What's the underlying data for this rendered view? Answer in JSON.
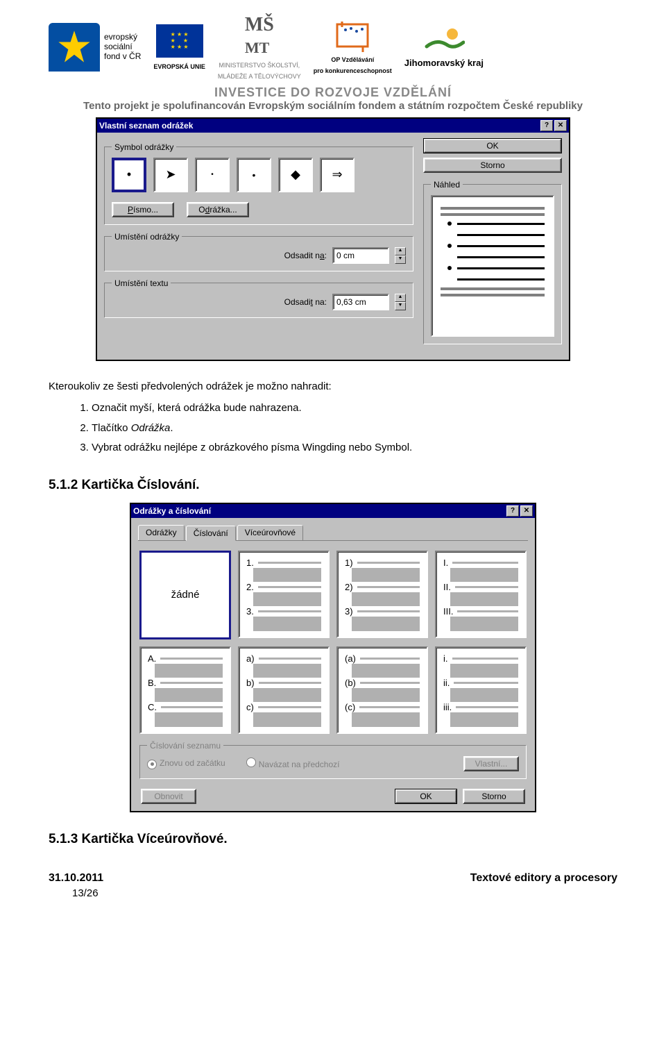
{
  "header": {
    "esf_text1": "evropský",
    "esf_text2": "sociální",
    "esf_text3": "fond v ČR",
    "eu_label": "EVROPSKÁ UNIE",
    "msmt_line1": "MINISTERSTVO ŠKOLSTVÍ,",
    "msmt_line2": "MLÁDEŽE A TĚLOVÝCHOVY",
    "op_line1": "OP Vzdělávání",
    "op_line2": "pro konkurenceschopnost",
    "jmk": "Jihomoravský kraj",
    "invest": "INVESTICE DO ROZVOJE VZDĚLÁNÍ",
    "cofund": "Tento projekt je spolufinancován Evropským sociálním fondem a státním rozpočtem České republiky"
  },
  "dialog1": {
    "title": "Vlastní seznam odrážek",
    "group_symbol": "Symbol odrážky",
    "btn_font": "Písmo...",
    "btn_bullet": "Odrážka...",
    "group_bullet_pos": "Umístění odrážky",
    "indent_at1_label": "Odsadit na:",
    "indent_at1_value": "0 cm",
    "group_text_pos": "Umístění textu",
    "indent_at2_label": "Odsadit na:",
    "indent_at2_value": "0,63 cm",
    "ok": "OK",
    "storno": "Storno",
    "preview_label": "Náhled",
    "symbols": [
      "•",
      "➤",
      "•",
      "•",
      "◆",
      "⇒"
    ]
  },
  "body": {
    "intro": "Kteroukoliv ze šesti předvolených odrážek je možno nahradit:",
    "steps": [
      "Označit myší, která odrážka bude nahrazena.",
      "Tlačítko Odrážka.",
      "Vybrat odrážku nejlépe z obrázkového písma Wingding nebo Symbol."
    ],
    "step2_italic": "Odrážka",
    "h512": "5.1.2 Kartička Číslování."
  },
  "dialog2": {
    "title": "Odrážky a číslování",
    "tabs": [
      "Odrážky",
      "Číslování",
      "Víceúrovňové"
    ],
    "active_tab": 1,
    "box_none": "žádné",
    "numbering": {
      "r1c2": [
        "1.",
        "2.",
        "3."
      ],
      "r1c3": [
        "1)",
        "2)",
        "3)"
      ],
      "r1c4": [
        "I.",
        "II.",
        "III."
      ],
      "r2c1": [
        "A.",
        "B.",
        "C."
      ],
      "r2c2": [
        "a)",
        "b)",
        "c)"
      ],
      "r2c3": [
        "(a)",
        "(b)",
        "(c)"
      ],
      "r2c4": [
        "i.",
        "ii.",
        "iii."
      ]
    },
    "group_list": "Číslování seznamu",
    "radio_restart": "Znovu od začátku",
    "radio_continue": "Navázat na předchozí",
    "btn_custom": "Vlastní...",
    "btn_reset": "Obnovit",
    "ok": "OK",
    "storno": "Storno"
  },
  "footer": {
    "h513": "5.1.3 Kartička Víceúrovňové.",
    "date": "31.10.2011",
    "doc_title": "Textové editory a procesory",
    "pagenum": "13/26"
  }
}
